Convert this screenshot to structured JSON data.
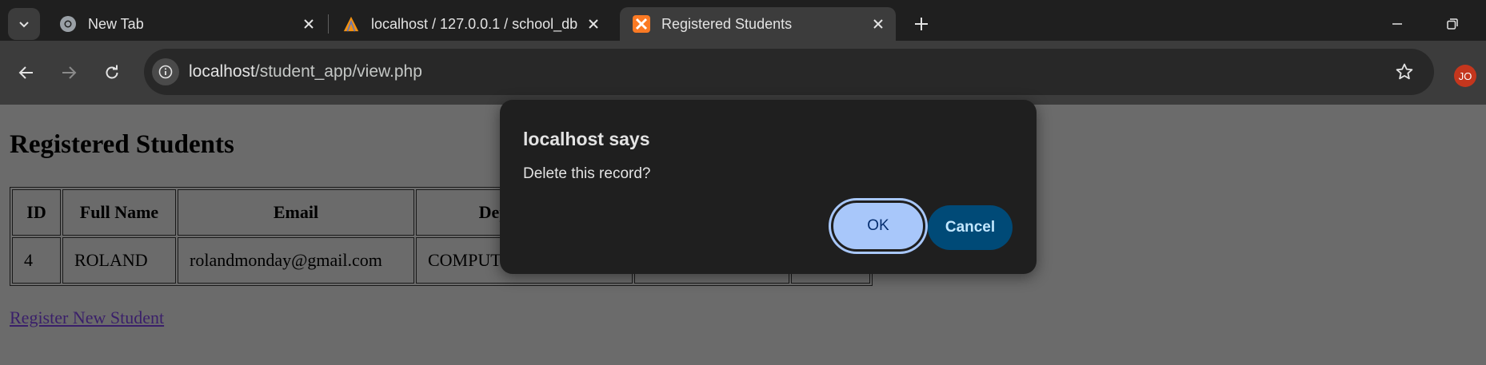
{
  "browser": {
    "tabs": [
      {
        "title": "New Tab",
        "active": false,
        "favicon": "chrome-icon"
      },
      {
        "title": "localhost / 127.0.0.1 / school_db",
        "active": false,
        "favicon": "phpmyadmin-icon"
      },
      {
        "title": "Registered Students",
        "active": true,
        "favicon": "xampp-icon"
      }
    ],
    "address": {
      "host": "localhost",
      "path": "/student_app/view.php"
    },
    "profile_initials": "JO"
  },
  "page": {
    "heading": "Registered Students",
    "table": {
      "headers": [
        "ID",
        "Full Name",
        "Email",
        "Department",
        "",
        ""
      ],
      "rows": [
        [
          "4",
          "ROLAND",
          "rolandmonday@gmail.com",
          "COMPUTER",
          "",
          ""
        ]
      ]
    },
    "register_link": "Register New Student"
  },
  "dialog": {
    "title": "localhost says",
    "message": "Delete this record?",
    "ok_label": "OK",
    "cancel_label": "Cancel"
  },
  "colors": {
    "tabstrip": "#1f1f1f",
    "toolbar": "#3c3c3c",
    "page_overlay": "#6b6b6b",
    "dialog_bg": "#1f1f1f",
    "ok_button": "#a8c7fa",
    "cancel_button": "#004a77",
    "avatar": "#c4361d"
  }
}
